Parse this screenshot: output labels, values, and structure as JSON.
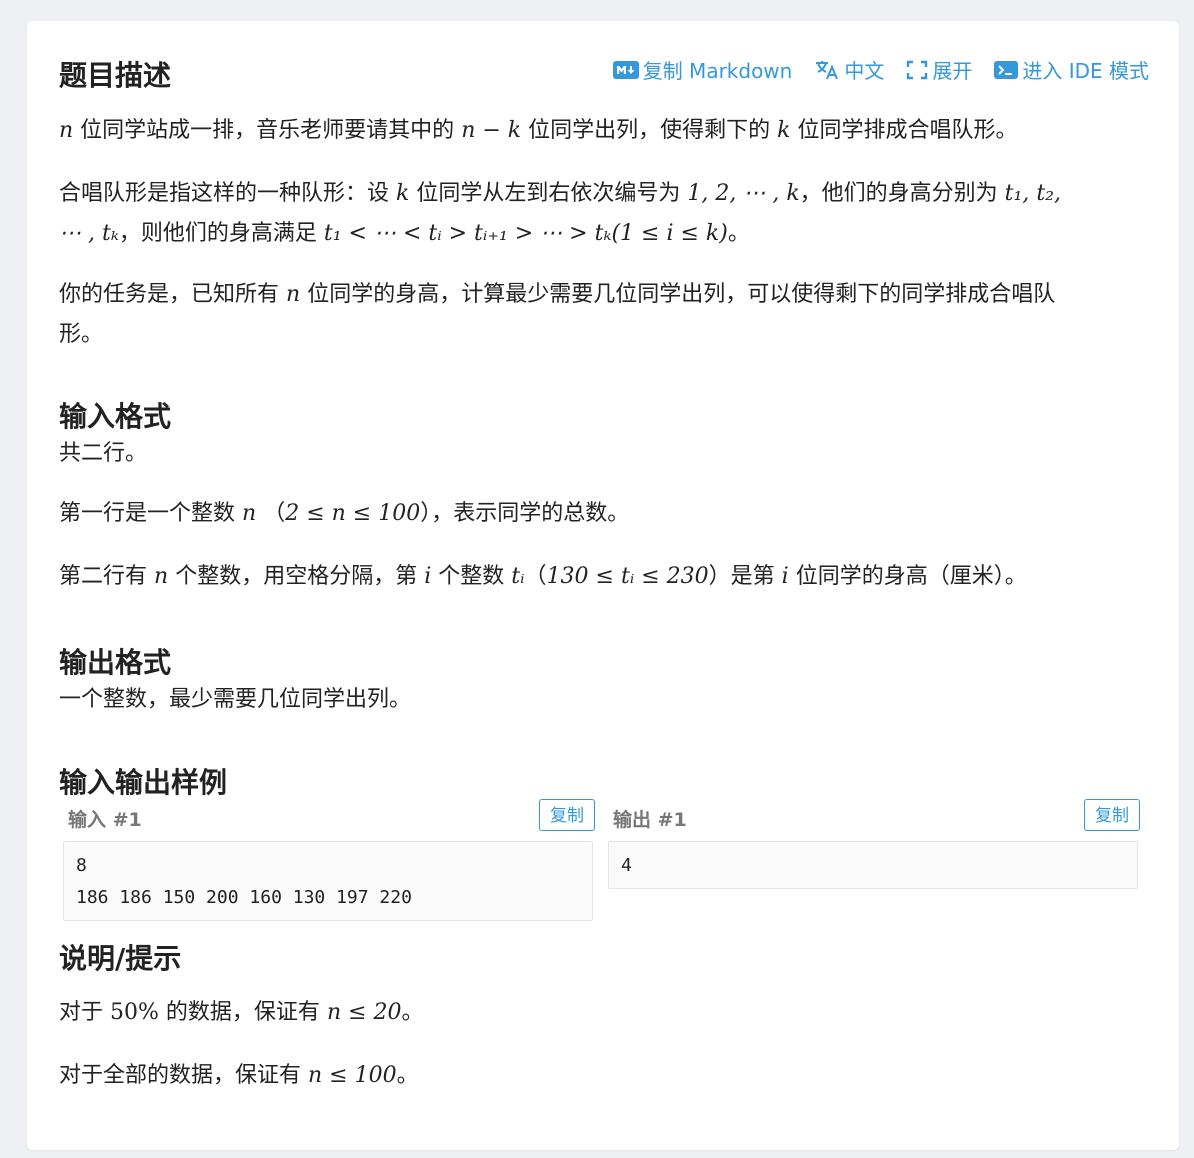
{
  "toolbar": {
    "copy_markdown": "复制 Markdown",
    "language": "中文",
    "expand": "展开",
    "ide_mode": "进入 IDE 模式"
  },
  "sections": {
    "description_title": "题目描述",
    "input_format_title": "输入格式",
    "output_format_title": "输出格式",
    "samples_title": "输入输出样例",
    "hint_title": "说明/提示"
  },
  "description": {
    "p1_a": "位同学站成一排，音乐老师要请其中的",
    "p1_b": "位同学出列，使得剩下的",
    "p1_c": "位同学排成合唱队形。",
    "p2_a": "合唱队形是指这样的一种队形：设",
    "p2_b": "位同学从左到右依次编号为",
    "p2_c": "，他们的身高分别为",
    "p2_d": "，则他们的身高满足",
    "p2_e": "。",
    "p3_a": "你的任务是，已知所有",
    "p3_b": "位同学的身高，计算最少需要几位同学出列，可以使得剩下的同学排成合唱队",
    "p3_c": "形。"
  },
  "input_format": {
    "line1": "共二行。",
    "line2_a": "第一行是一个整数",
    "line2_b": "（",
    "line2_c": "），表示同学的总数。",
    "line3_a": "第二行有",
    "line3_b": "个整数，用空格分隔，第",
    "line3_c": "个整数",
    "line3_d": "（",
    "line3_e": "）是第",
    "line3_f": "位同学的身高（厘米）。"
  },
  "output_format": {
    "line1": "一个整数，最少需要几位同学出列。"
  },
  "samples": {
    "input_label": "输入 #1",
    "output_label": "输出 #1",
    "copy_label": "复制",
    "input_text": "8\n186 186 150 200 160 130 197 220",
    "output_text": "4"
  },
  "hint": {
    "line1_a": "对于",
    "line1_b": "的数据，保证有",
    "line1_c": "。",
    "line2_a": "对于全部的数据，保证有",
    "line2_b": "。"
  },
  "math": {
    "n": "n",
    "k": "k",
    "i": "i",
    "n_minus_k": "n − k",
    "seq": "1, 2, ⋯ , k",
    "t1t2": "t₁, t₂,",
    "tk_cont": "⋯ , tₖ",
    "chain": "t₁ < ⋯ < tᵢ > tᵢ₊₁ > ⋯ > tₖ(1 ≤ i ≤ k)",
    "n_range": "2 ≤ n ≤ 100",
    "ti": "tᵢ",
    "t_range": "130 ≤ tᵢ ≤ 230",
    "pct": "50%",
    "n_le_20": "n ≤ 20",
    "n_le_100": "n ≤ 100"
  }
}
